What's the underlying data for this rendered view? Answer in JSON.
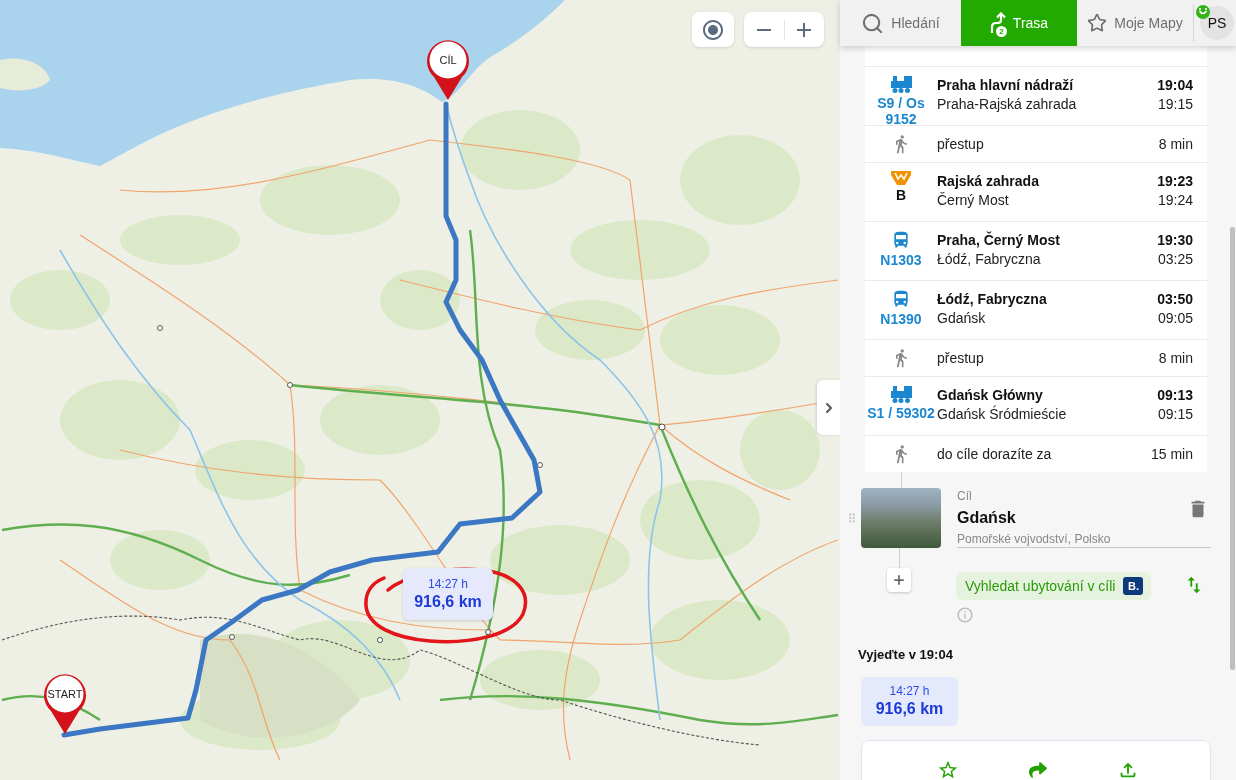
{
  "map": {
    "pins": [
      {
        "kind": "start",
        "label": "START"
      },
      {
        "kind": "destination",
        "label": "CÍL"
      }
    ],
    "route_summary": {
      "duration": "14:27 h",
      "distance": "916,6 km"
    }
  },
  "panel": {
    "tabs": [
      {
        "label": "Hledání",
        "selected": false
      },
      {
        "label": "Trasa",
        "badge": "2",
        "selected": true
      },
      {
        "label": "Moje Mapy",
        "selected": false
      }
    ],
    "user": {
      "initials": "PS"
    },
    "segments": [
      {
        "kind": "train",
        "line": "S9 / Os 9152",
        "from": "Praha hlavní nádraží",
        "to": "Praha-Rajská zahrada",
        "departure": "19:04",
        "arrival": "19:15"
      },
      {
        "kind": "walk",
        "text": "přestup",
        "duration": "8 min"
      },
      {
        "kind": "metro",
        "line": "B",
        "from": "Rajská zahrada",
        "to": "Černý Most",
        "departure": "19:23",
        "arrival": "19:24"
      },
      {
        "kind": "bus",
        "line": "N1303",
        "from": "Praha, Černý Most",
        "to": "Łódź, Fabryczna",
        "departure": "19:30",
        "arrival": "03:25"
      },
      {
        "kind": "bus",
        "line": "N1390",
        "from": "Łódź, Fabryczna",
        "to": "Gdańsk",
        "departure": "03:50",
        "arrival": "09:05"
      },
      {
        "kind": "walk",
        "text": "přestup",
        "duration": "8 min"
      },
      {
        "kind": "train",
        "line": "S1 / 59302",
        "from": "Gdańsk Główny",
        "to": "Gdańsk Śródmieście",
        "departure": "09:13",
        "arrival": "09:15"
      },
      {
        "kind": "walk",
        "text": "do cíle dorazíte za",
        "duration": "15 min"
      }
    ],
    "destination": {
      "label": "Cíl",
      "name": "Gdańsk",
      "region": "Pomořské vojvodství, Polsko"
    },
    "accommodation": {
      "label": "Vyhledat ubytování v cíli",
      "logo": "B."
    },
    "departure_heading": "Vyjeďte v 19:04",
    "route_options": [
      {
        "duration": "14:27 h",
        "distance": "916,6 km",
        "selected": true
      }
    ]
  }
}
